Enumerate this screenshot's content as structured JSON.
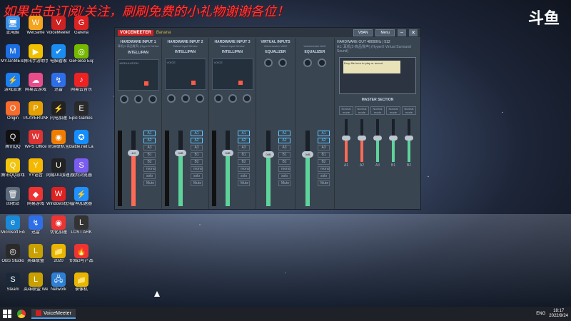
{
  "banner": {
    "text": "如果点击订阅/关注，刷刷免费的小礼物谢谢各位！",
    "logo": "斗鱼"
  },
  "desktop_icons": [
    {
      "label": "此电脑",
      "color": "#3a8ee6",
      "glyph": "🖥"
    },
    {
      "label": "WeGame",
      "color": "#f3a31c",
      "glyph": "W"
    },
    {
      "label": "VoiceMeeter Banana",
      "color": "#c22",
      "glyph": "V"
    },
    {
      "label": "Garena",
      "color": "#d22",
      "glyph": "G"
    },
    {
      "label": "MY.GAMES GameCenter",
      "color": "#1d6ee0",
      "glyph": "M"
    },
    {
      "label": "腾讯手游助手",
      "color": "#f0c000",
      "glyph": "▶"
    },
    {
      "label": "电脑管家",
      "color": "#1b8df0",
      "glyph": "✔"
    },
    {
      "label": "GeForce Experience",
      "color": "#76b900",
      "glyph": "◎"
    },
    {
      "label": "游戏加速",
      "color": "#1a7ff0",
      "glyph": "⚡"
    },
    {
      "label": "网易云游戏",
      "color": "#e84d8a",
      "glyph": "☁"
    },
    {
      "label": "迅雷",
      "color": "#2e6fe8",
      "glyph": "↯"
    },
    {
      "label": "网易云音乐",
      "color": "#e22",
      "glyph": "♪"
    },
    {
      "label": "Origin",
      "color": "#f56c2d",
      "glyph": "O"
    },
    {
      "label": "PLAYERUNKNOWN'S BATTLEGROUNDS",
      "color": "#e6a000",
      "glyph": "P"
    },
    {
      "label": "闪电加速",
      "color": "#222",
      "glyph": "⚡"
    },
    {
      "label": "Epic Games Launcher",
      "color": "#2a2a2a",
      "glyph": "E"
    },
    {
      "label": "腾讯QQ",
      "color": "#111",
      "glyph": "Q"
    },
    {
      "label": "WPS Office",
      "color": "#d33",
      "glyph": "W"
    },
    {
      "label": "奇游联机宝",
      "color": "#f07d00",
      "glyph": "◉"
    },
    {
      "label": "Battle.net Launcher",
      "color": "#148eff",
      "glyph": "✪"
    },
    {
      "label": "腾讯QQ游戏",
      "color": "#f1c40f",
      "glyph": "Q"
    },
    {
      "label": "YY语音",
      "color": "#f5b800",
      "glyph": "Y"
    },
    {
      "label": "网易UU加速器",
      "color": "#222",
      "glyph": "U"
    },
    {
      "label": "搜狗浏览器",
      "color": "#7b5cf0",
      "glyph": "S"
    },
    {
      "label": "回收站",
      "color": "#5b6a7a",
      "glyph": "🗑"
    },
    {
      "label": "网易游戏",
      "color": "#e33",
      "glyph": "◆"
    },
    {
      "label": "Windows优化大师",
      "color": "#d22",
      "glyph": "W"
    },
    {
      "label": "雷神加速器",
      "color": "#1e90ff",
      "glyph": "⚡"
    },
    {
      "label": "Microsoft Edge",
      "color": "#1a8ad8",
      "glyph": "e"
    },
    {
      "label": "迅雷",
      "color": "#2e6fe8",
      "glyph": "↯"
    },
    {
      "label": "优化加速",
      "color": "#e33",
      "glyph": "◉"
    },
    {
      "label": "LOST ARK",
      "color": "#333",
      "glyph": "L"
    },
    {
      "label": "OBS Studio",
      "color": "#2a2a2a",
      "glyph": "◎"
    },
    {
      "label": "英雄联盟",
      "color": "#c8a000",
      "glyph": "L"
    },
    {
      "label": "2020",
      "color": "#e8b600",
      "glyph": "📁"
    },
    {
      "label": "炽焰3号产品",
      "color": "#e33",
      "glyph": "🔥"
    },
    {
      "label": "Steam",
      "color": "#1b2838",
      "glyph": "S"
    },
    {
      "label": "英雄联盟 WeGame版",
      "color": "#c8a000",
      "glyph": "L"
    },
    {
      "label": "Network",
      "color": "#2f7fd4",
      "glyph": "🖧"
    },
    {
      "label": "录像机",
      "color": "#e8b600",
      "glyph": "📁"
    }
  ],
  "vm": {
    "logo": "VOICEMEETER",
    "sub": "Banana",
    "visual_btn": "VBAN",
    "menu_btn": "Menu",
    "strips": [
      {
        "head": "HARDWARE INPUT 1",
        "sub": "耳机(2-高品質声) (HyperX Virtua",
        "label": "INTELLIPAN",
        "mode": "MODULATION",
        "gain": "-8.0",
        "fill": "#ff6a55",
        "level": 0.72
      },
      {
        "head": "HARDWARE INPUT 2",
        "sub": "Select Input Device",
        "label": "INTELLIPAN",
        "mode": "VOICE",
        "gain": "0dB",
        "fill": "#5ed39a",
        "level": 0.72
      },
      {
        "head": "HARDWARE INPUT 3",
        "sub": "Select Input Device",
        "label": "INTELLIPAN",
        "mode": "VOICE",
        "gain": "0dB",
        "fill": "#5ed39a",
        "level": 0.72
      }
    ],
    "vi_head": "VIRTUAL INPUTS",
    "vi": [
      {
        "sub": "Voicemeeter VAIO",
        "label": "EQUALIZER",
        "gain": "0dB"
      },
      {
        "sub": "Voicemeeter AUX",
        "label": "EQUALIZER",
        "gain": "0dB"
      }
    ],
    "bus_labels": [
      "A1",
      "A2",
      "A3",
      "B1",
      "B2",
      "mono",
      "solo",
      "Mute"
    ],
    "hw_out": "HARDWARE OUT  48000Hz | 512",
    "hw_out_dev": "A1: 耳机(2-高品質声) (HyperX Virtual Surround Sound)",
    "tape_msg": "Drop file here to play or record",
    "master_head": "MASTER SECTION",
    "masters": [
      "A1",
      "A2",
      "A3",
      "B1",
      "B2"
    ],
    "master_modes": [
      "Normal mode",
      "Normal mode",
      "Normal mode",
      "Normal mode",
      "Normal mode"
    ],
    "master_colors": [
      "#ff6a55",
      "#ff6a55",
      "#5ed39a",
      "#5ed39a",
      "#5ed39a"
    ],
    "master_levels": [
      0.55,
      0.55,
      0.55,
      0.55,
      0.55
    ]
  },
  "taskbar": {
    "app_label": "VoiceMeeter",
    "tray": "ENG",
    "time": "18:17",
    "date": "2022/9/24"
  }
}
